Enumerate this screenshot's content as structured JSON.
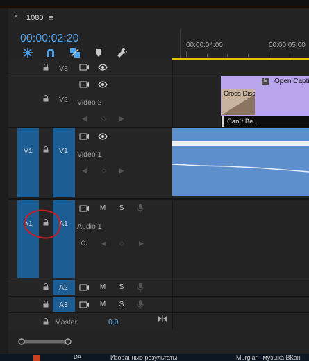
{
  "panel": {
    "close_glyph": "×",
    "title": "1080",
    "menu_glyph": "≡"
  },
  "playhead_timecode": "00:00:02:20",
  "ruler": {
    "labels": [
      "00:00:04:00",
      "00:00:05:00"
    ]
  },
  "toolbar": {
    "icons": [
      "snap-icon",
      "magnet-icon",
      "linked-selection-icon",
      "marker-icon",
      "wrench-icon"
    ]
  },
  "tracks": {
    "v3": {
      "label": "V3"
    },
    "v2": {
      "label": "V2",
      "name": "Video 2"
    },
    "v1": {
      "label": "V1",
      "source_label": "V1",
      "name": "Video 1"
    },
    "a1": {
      "label": "A1",
      "source_label": "A1",
      "name": "Audio 1",
      "mute": "M",
      "solo": "S"
    },
    "a2": {
      "label": "A2",
      "mute": "M",
      "solo": "S"
    },
    "a3": {
      "label": "A3",
      "mute": "M",
      "solo": "S"
    },
    "master": {
      "name": "Master",
      "value": "0,0"
    }
  },
  "clips": {
    "caption_title": "Open Caption",
    "caption_fx": "fx",
    "transition": "Cross Disso",
    "caption_text": "Can`t Be..."
  },
  "taskbar": {
    "items": [
      "Изоранные результаты",
      "Murgiar - музыка ВКон"
    ],
    "da": "DA"
  },
  "colors": {
    "timecode": "#4aa3ef",
    "track_target": "#1c5d93",
    "caption_clip": "#b9a6ec",
    "video_clip": "#5d8fcd",
    "work_area": "#e6c400",
    "annotation": "#d0191e"
  }
}
